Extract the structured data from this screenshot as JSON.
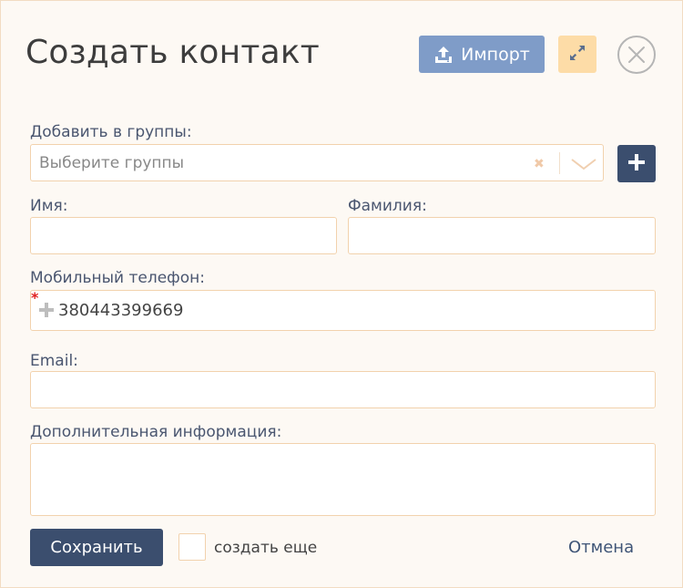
{
  "dialog": {
    "title": "Создать контакт",
    "import_label": "Импорт"
  },
  "groups": {
    "label": "Добавить в группы:",
    "placeholder": "Выберите группы",
    "clear_symbol": "✖"
  },
  "first_name": {
    "label": "Имя:",
    "value": ""
  },
  "last_name": {
    "label": "Фамилия:",
    "value": ""
  },
  "phone": {
    "label": "Мобильный телефон:",
    "required_mark": "*",
    "value": "380443399669"
  },
  "email": {
    "label": "Email:",
    "value": ""
  },
  "notes": {
    "label": "Дополнительная информация:",
    "value": ""
  },
  "footer": {
    "save_label": "Сохранить",
    "create_more_label": "создать еще",
    "cancel_label": "Отмена"
  },
  "colors": {
    "accent_dark": "#3b4e6e",
    "import_blue": "#7f9cc8",
    "expand_peach": "#fddca7",
    "field_border": "#f2d2ad"
  },
  "icons": [
    "upload-icon",
    "expand-icon",
    "close-circle-icon",
    "chevron-down-icon",
    "plus-icon"
  ]
}
